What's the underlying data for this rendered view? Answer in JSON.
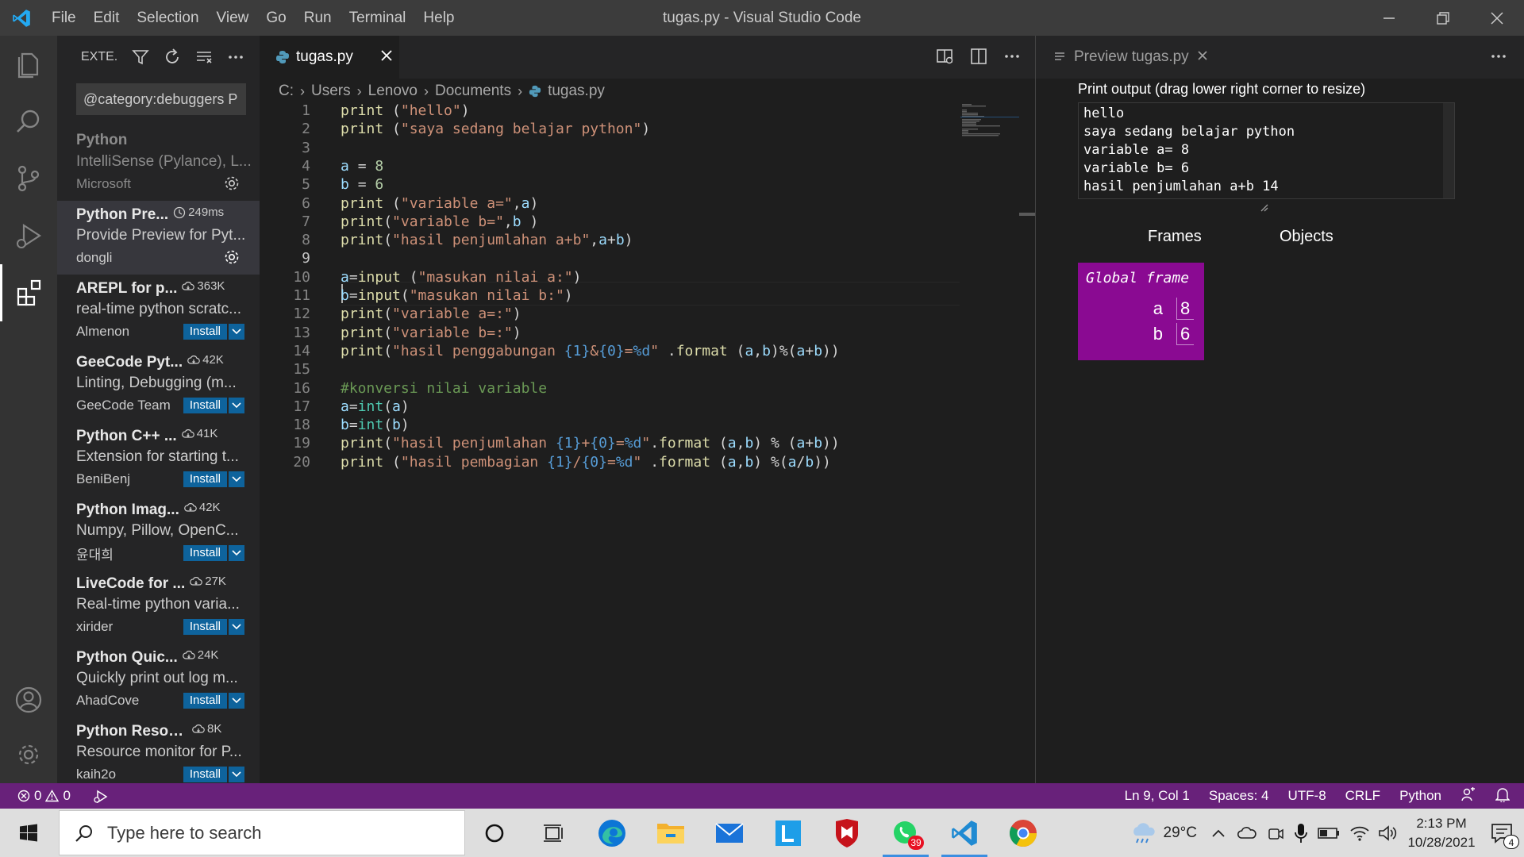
{
  "app": {
    "window_title": "tugas.py - Visual Studio Code",
    "menu": [
      "File",
      "Edit",
      "Selection",
      "View",
      "Go",
      "Run",
      "Terminal",
      "Help"
    ]
  },
  "sidebar": {
    "title": "EXTE...",
    "search_value": "@category:debuggers P",
    "extensions": [
      {
        "name": "Python",
        "description": "IntelliSense (Pylance), L...",
        "publisher": "Microsoft",
        "downloads": "",
        "action": "gear",
        "state": "disabled"
      },
      {
        "name": "Python Pre...",
        "description": "Provide Preview for Pyt...",
        "publisher": "dongli",
        "downloads": "249ms",
        "action": "gear",
        "state": "selected"
      },
      {
        "name": "AREPL for p...",
        "description": "real-time python scratc...",
        "publisher": "Almenon",
        "downloads": "363K",
        "action": "Install",
        "state": "normal"
      },
      {
        "name": "GeeCode Pyt...",
        "description": "Linting, Debugging (m...",
        "publisher": "GeeCode Team",
        "downloads": "42K",
        "action": "Install",
        "state": "normal"
      },
      {
        "name": "Python C++ ...",
        "description": "Extension for starting t...",
        "publisher": "BeniBenj",
        "downloads": "41K",
        "action": "Install",
        "state": "normal"
      },
      {
        "name": "Python Imag...",
        "description": "Numpy, Pillow, OpenC...",
        "publisher": "윤대희",
        "downloads": "42K",
        "action": "Install",
        "state": "normal"
      },
      {
        "name": "LiveCode for ...",
        "description": "Real-time python varia...",
        "publisher": "xirider",
        "downloads": "27K",
        "action": "Install",
        "state": "normal"
      },
      {
        "name": "Python Quic...",
        "description": "Quickly print out log m...",
        "publisher": "AhadCove",
        "downloads": "24K",
        "action": "Install",
        "state": "normal"
      },
      {
        "name": "Python Resou...",
        "description": "Resource monitor for P...",
        "publisher": "kaih2o",
        "downloads": "8K",
        "action": "Install",
        "state": "normal"
      }
    ]
  },
  "editor": {
    "tab_label": "tugas.py",
    "breadcrumb": [
      "C:",
      "Users",
      "Lenovo",
      "Documents",
      "tugas.py"
    ],
    "current_line": 9,
    "lines": [
      "print (\"hello\")",
      "print (\"saya sedang belajar python\")",
      "",
      "a = 8",
      "b = 6",
      "print (\"variable a=\",a)",
      "print(\"variable b=\",b )",
      "print(\"hasil penjumlahan a+b\",a+b)",
      "",
      "a=input (\"masukan nilai a:\")",
      "b=input(\"masukan nilai b:\")",
      "print(\"variable a=:\")",
      "print(\"variable b=:\")",
      "print(\"hasil penggabungan {1}&{0}=%d\" .format (a,b)%(a+b))",
      "",
      "#konversi nilai variable",
      "a=int(a)",
      "b=int(b)",
      "print(\"hasil penjumlahan {1}+{0}=%d\".format (a,b) % (a+b))",
      "print (\"hasil pembagian {1}/{0}=%d\" .format (a,b) %(a/b))"
    ]
  },
  "preview": {
    "tab_label": "Preview tugas.py",
    "output_label": "Print output (drag lower right corner to resize)",
    "output_lines": [
      "hello",
      "saya sedang belajar python",
      "variable a= 8",
      "variable b= 6",
      "hasil penjumlahan a+b 14"
    ],
    "frames_header": "Frames",
    "objects_header": "Objects",
    "frame_title": "Global frame",
    "variables": [
      {
        "name": "a",
        "value": "8"
      },
      {
        "name": "b",
        "value": "6"
      }
    ],
    "frame_color": "#8a0a92"
  },
  "statusbar": {
    "errors": "0",
    "warnings": "0",
    "position": "Ln 9, Col 1",
    "spaces": "Spaces: 4",
    "encoding": "UTF-8",
    "eol": "CRLF",
    "language": "Python",
    "color": "#68217a"
  },
  "taskbar": {
    "search_placeholder": "Type here to search",
    "whatsapp_badge": "39",
    "temperature": "29°C",
    "time": "2:13 PM",
    "date": "10/28/2021",
    "notification_count": "4"
  }
}
